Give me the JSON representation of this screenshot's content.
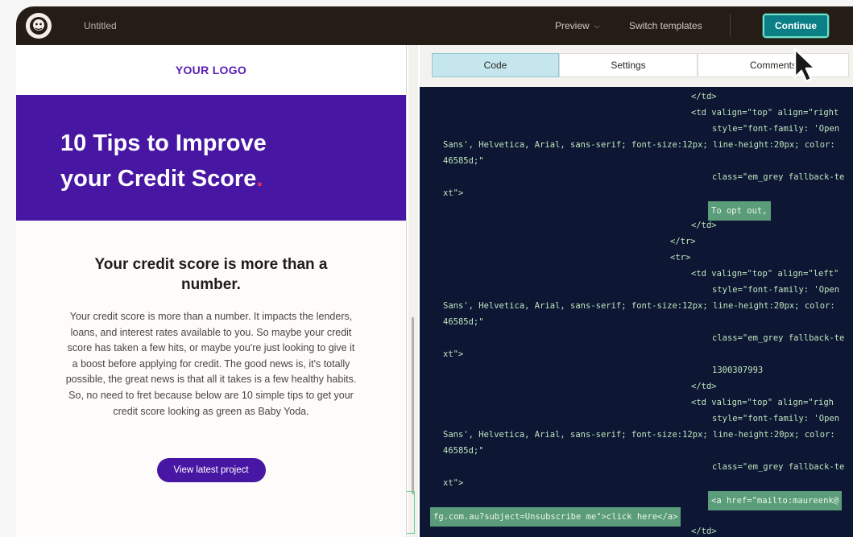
{
  "topbar": {
    "document_title": "Untitled",
    "preview_label": "Preview",
    "switch_templates_label": "Switch templates",
    "continue_label": "Continue"
  },
  "email_preview": {
    "logo_text": "YOUR LOGO",
    "hero_title": "10 Tips to Improve your Credit Score",
    "hero_title_dot": ".",
    "heading": "Your credit score is more than a number.",
    "body": "Your credit score is more than a number. It impacts the lenders, loans, and interest rates available to you. So maybe your credit score has taken a few hits, or maybe you're just looking to give it a boost before applying for credit. The good news is, it's totally possible, the great news is that all it takes is a few healthy habits. So, no need to fret because below are 10 simple tips to get your credit score looking as green as Baby Yoda.",
    "cta_label": "View latest project",
    "colors": {
      "brand_purple": "#4717a3",
      "accent_dot": "#e8315b"
    }
  },
  "editor": {
    "tabs": [
      {
        "label": "Code",
        "active": true
      },
      {
        "label": "Settings",
        "active": false
      },
      {
        "label": "Comments",
        "active": false
      }
    ],
    "code_lines": [
      "</td>",
      "<td valign=\"top\" align=\"right",
      "style=\"font-family: 'Open",
      "Sans', Helvetica, Arial, sans-serif; font-size:12px; line-height:20px; color:",
      "46585d;\"",
      "class=\"em_grey fallback-te",
      "xt\">",
      "To opt out,",
      "</td>",
      "</tr>",
      "<tr>",
      "<td valign=\"top\" align=\"left\"",
      "style=\"font-family: 'Open",
      "Sans', Helvetica, Arial, sans-serif; font-size:12px; line-height:20px; color:",
      "46585d;\"",
      "class=\"em_grey fallback-te",
      "xt\">",
      "1300307993",
      "</td>",
      "<td valign=\"top\" align=\"righ",
      "style=\"font-family: 'Open",
      "Sans', Helvetica, Arial, sans-serif; font-size:12px; line-height:20px; color:",
      "46585d;\"",
      "class=\"em_grey fallback-te",
      "xt\">",
      "<a href=\"mailto:maureenk@",
      "fg.com.au?subject=Unsubscribe me\">click here</a>",
      "</td>"
    ]
  }
}
